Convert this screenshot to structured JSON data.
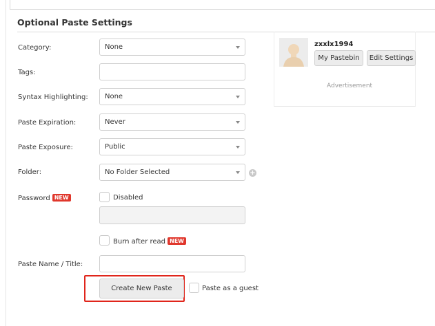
{
  "section": {
    "title": "Optional Paste Settings"
  },
  "form": {
    "category": {
      "label": "Category:",
      "value": "None"
    },
    "tags": {
      "label": "Tags:",
      "value": ""
    },
    "syntax": {
      "label": "Syntax Highlighting:",
      "value": "None"
    },
    "expiration": {
      "label": "Paste Expiration:",
      "value": "Never"
    },
    "exposure": {
      "label": "Paste Exposure:",
      "value": "Public"
    },
    "folder": {
      "label": "Folder:",
      "value": "No Folder Selected"
    },
    "password": {
      "label": "Password",
      "badge": "NEW",
      "checkbox_label": "Disabled",
      "value": ""
    },
    "burn": {
      "label": "Burn after read",
      "badge": "NEW"
    },
    "paste_name": {
      "label": "Paste Name / Title:",
      "value": ""
    },
    "submit_label": "Create New Paste",
    "guest_label": "Paste as a guest"
  },
  "user_panel": {
    "username": "zxxlx1994",
    "my_pastebin": "My Pastebin",
    "edit_settings": "Edit Settings",
    "advertisement": "Advertisement"
  },
  "icons": {
    "add_folder": "plus-circle-icon",
    "dropdown": "chevron-down-icon",
    "avatar": "user-avatar-icon"
  },
  "colors": {
    "badge": "#e0372c",
    "highlight": "#e0251b"
  }
}
